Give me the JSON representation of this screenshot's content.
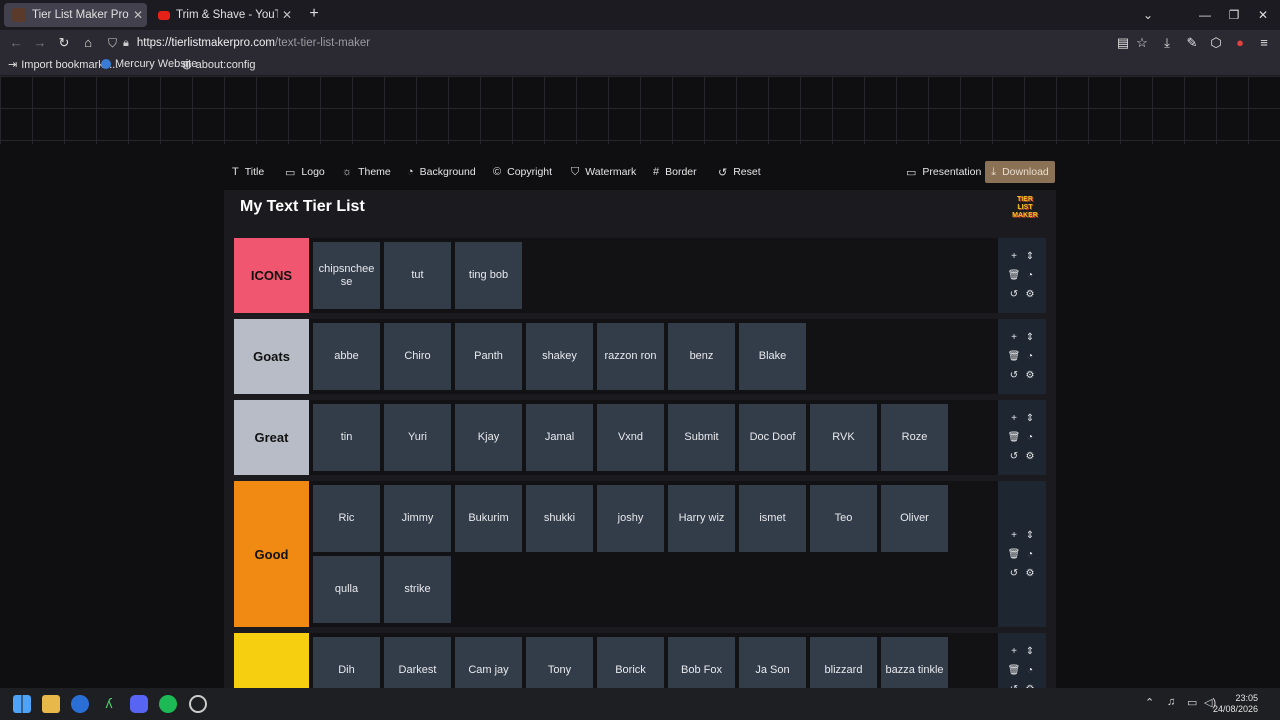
{
  "browser": {
    "tabs": [
      {
        "title": "Tier List Maker Pro - Free Text T",
        "close": "✕"
      },
      {
        "title": "Trim & Shave - YouTube",
        "close": "✕"
      }
    ],
    "new_tab": "+",
    "url_host": "https://tierlistmakerpro.com",
    "url_path": "/text-tier-list-maker",
    "bookmarks": [
      "Import bookmarks...",
      "Mercury Website",
      "about:config"
    ]
  },
  "toolbar": {
    "title": "Title",
    "logo": "Logo",
    "theme": "Theme",
    "background": "Background",
    "copyright": "Copyright",
    "watermark": "Watermark",
    "border": "Border",
    "reset": "Reset",
    "presentation": "Presentation",
    "download": "Download"
  },
  "panel": {
    "title": "My Text Tier List",
    "logo_lines": [
      "TIER",
      "LIST",
      "MAKER"
    ]
  },
  "tiers": [
    {
      "label": "ICONS",
      "color": "#f0566f",
      "items": [
        "chipsncheese",
        "tut",
        "ting bob"
      ]
    },
    {
      "label": "Goats",
      "color": "#b8bcc6",
      "items": [
        "abbe",
        "Chiro",
        "Panth",
        "shakey",
        "razzon ron",
        "benz",
        "Blake"
      ]
    },
    {
      "label": "Great",
      "color": "#b8bcc6",
      "items": [
        "tin",
        "Yuri",
        "Kjay",
        "Jamal",
        "Vxnd",
        "Submit",
        "Doc Doof",
        "RVK",
        "Roze"
      ]
    },
    {
      "label": "Good",
      "color": "#f08a12",
      "items": [
        "Ric",
        "Jimmy",
        "Bukurim",
        "shukki",
        "joshy",
        "Harry wiz",
        "ismet",
        "Teo",
        "Oliver",
        "qulla",
        "strike"
      ]
    },
    {
      "label": "",
      "color": "#f5cf10",
      "items": [
        "Dih",
        "Darkest",
        "Cam jay",
        "Tony",
        "Borick",
        "Bob Fox",
        "Ja Son",
        "blizzard",
        "bazza tinkle"
      ]
    }
  ],
  "clock": {
    "time": "23:05",
    "date": "24/08/2026"
  }
}
